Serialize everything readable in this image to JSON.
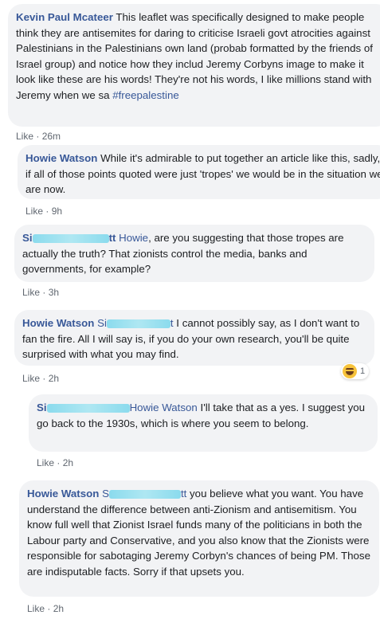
{
  "comments": [
    {
      "author": "Kevin Paul Mcateer",
      "text": " This leaflet was specifically designed to make people think they are antisemites for daring to criticise Israeli govt atrocities against Palestinians in the Palestinians own land (probab formatted by the friends of Israel group) and notice how they includ Jeremy Corbyns image to make it look like these are his words! They're not his words, I like millions stand with Jeremy when we sa ",
      "hashtag": "#freepalestine",
      "like_label": "Like",
      "time": "26m"
    },
    {
      "author": "Howie Watson",
      "text": " While it's admirable to put together an article like this, sadly, if all of those points quoted were just 'tropes' we would be in the situation we are now.",
      "like_label": "Like",
      "time": "9h"
    },
    {
      "author_start": "Si",
      "author_end": "tt",
      "mention": " Howie",
      "text": ", are you suggesting that those tropes are actually the truth? That zionists control the media, banks and governments, for example?",
      "like_label": "Like",
      "time": "3h"
    },
    {
      "author": "Howie Watson",
      "mention_start": " Si",
      "mention_end": "t",
      "text": " I cannot possibly say, as I don't want to fan the fire. All I will say is, if you do your own research, you'll be quite surprised with what you may find.",
      "like_label": "Like",
      "time": "2h",
      "reaction_count": "1"
    },
    {
      "author_start": "Si",
      "mention": "Howie Watson",
      "text": " I'll take that as a yes. I suggest you go back to the 1930s, which is where you seem to belong.",
      "like_label": "Like",
      "time": "2h"
    },
    {
      "author": "Howie Watson",
      "mention_start": " S",
      "mention_end": "tt",
      "text": " you believe what you want. You have understand the difference between anti-Zionism and antisemitism. You know full well that Zionist Israel funds many of the politicians in both the Labour party and Conservative, and you also know that the Zionists were responsible for sabotaging Jeremy Corbyn's chances of being PM. Those are indisputable facts. Sorry if that upsets you.",
      "like_label": "Like",
      "time": "2h"
    }
  ],
  "separator": " · "
}
